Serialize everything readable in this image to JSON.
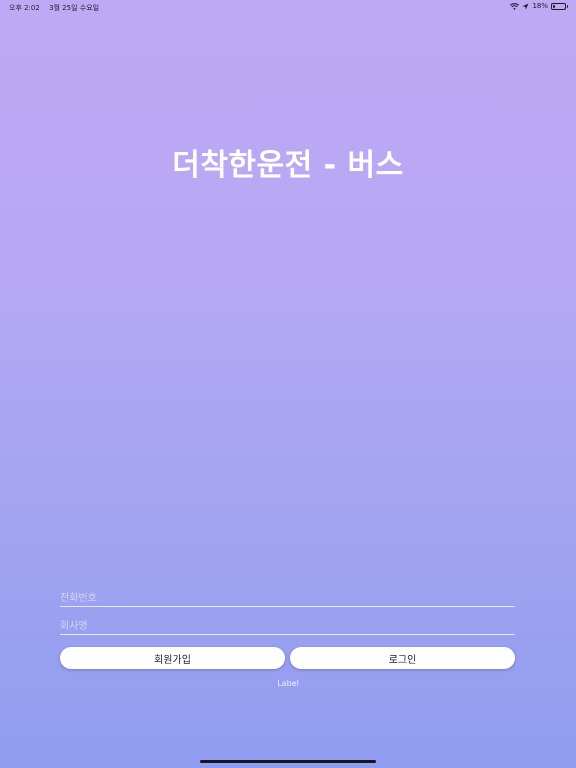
{
  "status_bar": {
    "time": "오후 2:02",
    "date": "3월 25일 수요일",
    "battery_percent": "18%",
    "battery_level": 0.18,
    "wifi_icon": "wifi-icon",
    "location_icon": "location-arrow-icon",
    "battery_icon": "battery-icon"
  },
  "app": {
    "title": "더착한운전 - 버스"
  },
  "form": {
    "phone_placeholder": "전화번호",
    "company_placeholder": "회사명",
    "signup_label": "회원가입",
    "login_label": "로그인",
    "status_label": "Label"
  },
  "colors": {
    "gradient_top": "#bea9f4",
    "gradient_bottom": "#8f9df0",
    "button_bg": "#ffffff"
  }
}
